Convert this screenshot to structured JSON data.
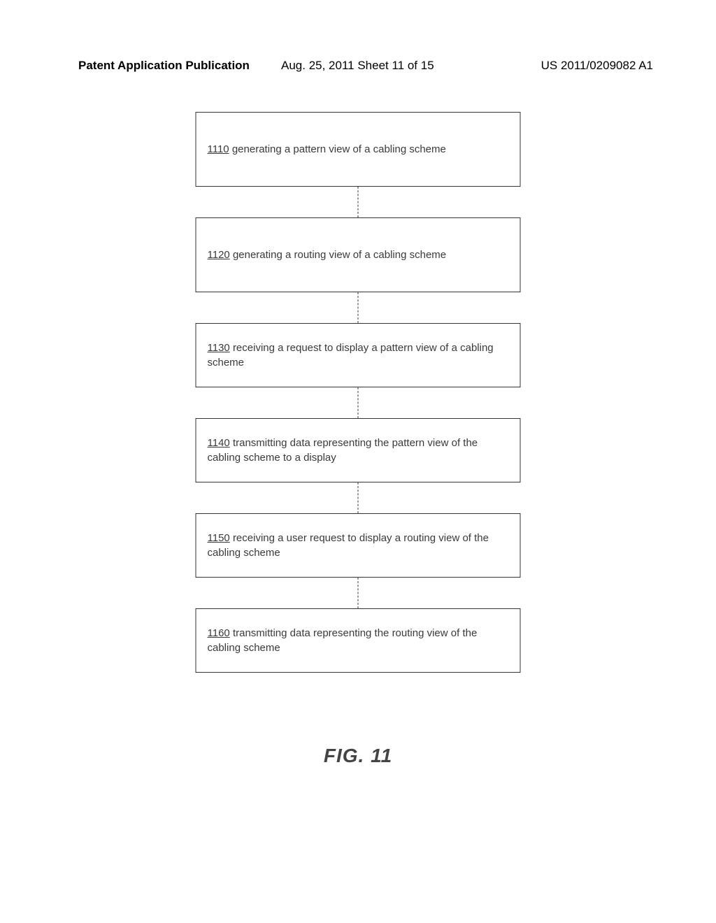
{
  "header": {
    "left": "Patent Application Publication",
    "center": "Aug. 25, 2011  Sheet 11 of 15",
    "right": "US 2011/0209082 A1"
  },
  "chart_data": {
    "type": "flowchart",
    "direction": "vertical",
    "nodes": [
      {
        "id": "1110",
        "text": "generating a pattern view of a cabling scheme"
      },
      {
        "id": "1120",
        "text": "generating a routing view of a cabling scheme"
      },
      {
        "id": "1130",
        "text": "receiving a request to display a pattern view of a cabling scheme"
      },
      {
        "id": "1140",
        "text": "transmitting data representing the pattern view of the cabling scheme to a display"
      },
      {
        "id": "1150",
        "text": "receiving a user request to display a routing view of the cabling scheme"
      },
      {
        "id": "1160",
        "text": "transmitting data representing the routing view of the cabling scheme"
      }
    ],
    "edges": [
      [
        "1110",
        "1120"
      ],
      [
        "1120",
        "1130"
      ],
      [
        "1130",
        "1140"
      ],
      [
        "1140",
        "1150"
      ],
      [
        "1150",
        "1160"
      ]
    ]
  },
  "figure_label": "FIG. 11"
}
